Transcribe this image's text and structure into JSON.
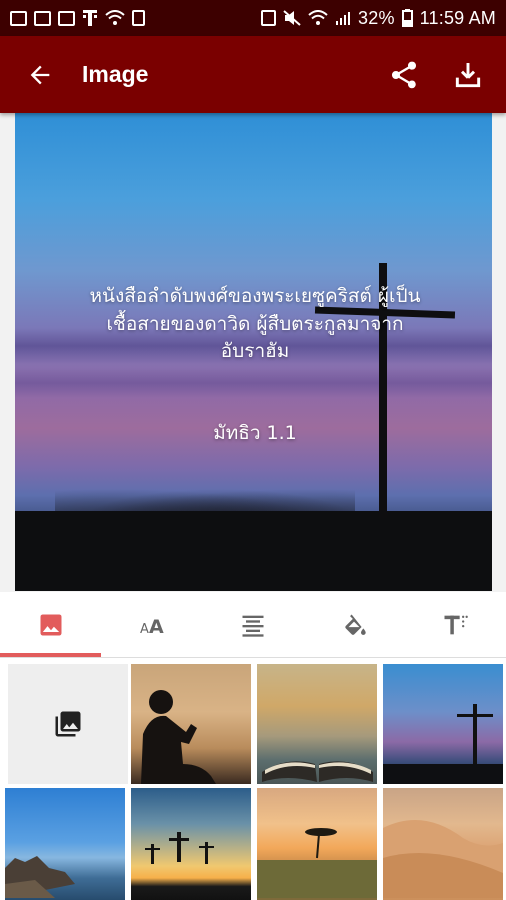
{
  "status_bar": {
    "battery": "32%",
    "time": "11:59 AM"
  },
  "app_bar": {
    "title": "Image",
    "back_icon": "arrow-back-icon",
    "share_icon": "share-icon",
    "download_icon": "download-icon"
  },
  "preview": {
    "verse_line1": "หนังสือลำดับพงศ์ของพระเยซูคริสต์ ผู้เป็น",
    "verse_line2": "เชื้อสายของดาวิด ผู้สืบตระกูลมาจาก",
    "verse_line3": "อับราฮัม",
    "reference": "มัทธิว 1.1"
  },
  "tabs": [
    {
      "name": "background-image",
      "icon": "image-icon",
      "active": true
    },
    {
      "name": "font-size",
      "icon": "font-size-icon",
      "active": false
    },
    {
      "name": "text-align",
      "icon": "align-center-icon",
      "active": false
    },
    {
      "name": "color-fill",
      "icon": "paint-bucket-icon",
      "active": false
    },
    {
      "name": "text-style",
      "icon": "text-format-icon",
      "active": false
    }
  ],
  "colors": {
    "status_bar": "#3d0000",
    "app_bar": "#7a0000",
    "accent": "#e25c5c"
  },
  "gallery": {
    "picker_icon": "photo-library-icon",
    "thumbnails": [
      "reading-silhouette",
      "open-bible-sunset",
      "cross-dusk",
      "beach-rocks",
      "three-crosses-sunset",
      "savanna-tree-sunset",
      "desert-dunes"
    ]
  }
}
